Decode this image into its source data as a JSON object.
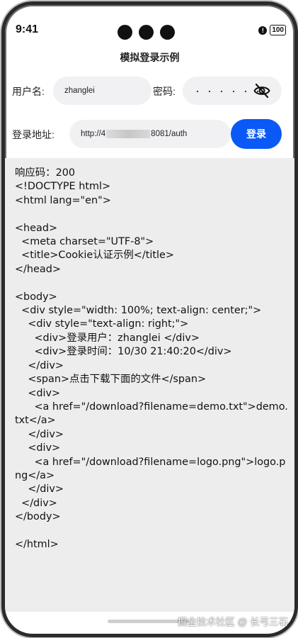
{
  "status_bar": {
    "time": "9:41",
    "battery": "100",
    "alert_glyph": "!"
  },
  "page": {
    "title": "模拟登录示例"
  },
  "form": {
    "username_label": "用户名:",
    "username_value": "zhanglei",
    "password_label": "密码:",
    "password_value": "· · · · · ·",
    "url_label": "登录地址:",
    "url_prefix": "http://4",
    "url_suffix": "8081/auth",
    "login_button": "登录"
  },
  "response": {
    "text": "响应码：200\n<!DOCTYPE html>\n<html lang=\"en\">\n\n<head>\n  <meta charset=\"UTF-8\">\n  <title>Cookie认证示例</title>\n</head>\n\n<body>\n  <div style=\"width: 100%; text-align: center;\">\n    <div style=\"text-align: right;\">\n      <div>登录用户：zhanglei </div>\n      <div>登录时间：10/30 21:40:20</div>\n    </div>\n    <span>点击下载下面的文件</span>\n    <div>\n      <a href=\"/download?filename=demo.txt\">demo.txt</a>\n    </div>\n    <div>\n      <a href=\"/download?filename=logo.png\">logo.png</a>\n    </div>\n  </div>\n</body>\n\n</html>"
  },
  "footer": {
    "watermark": "掘金技术社区 @ 长弓三石"
  },
  "icons": {
    "eye": "eye-off-icon",
    "alert": "alert-icon",
    "battery": "battery-icon"
  },
  "colors": {
    "primary": "#0a59f7",
    "input_bg": "#f1f1f3",
    "response_bg": "#ededed"
  }
}
